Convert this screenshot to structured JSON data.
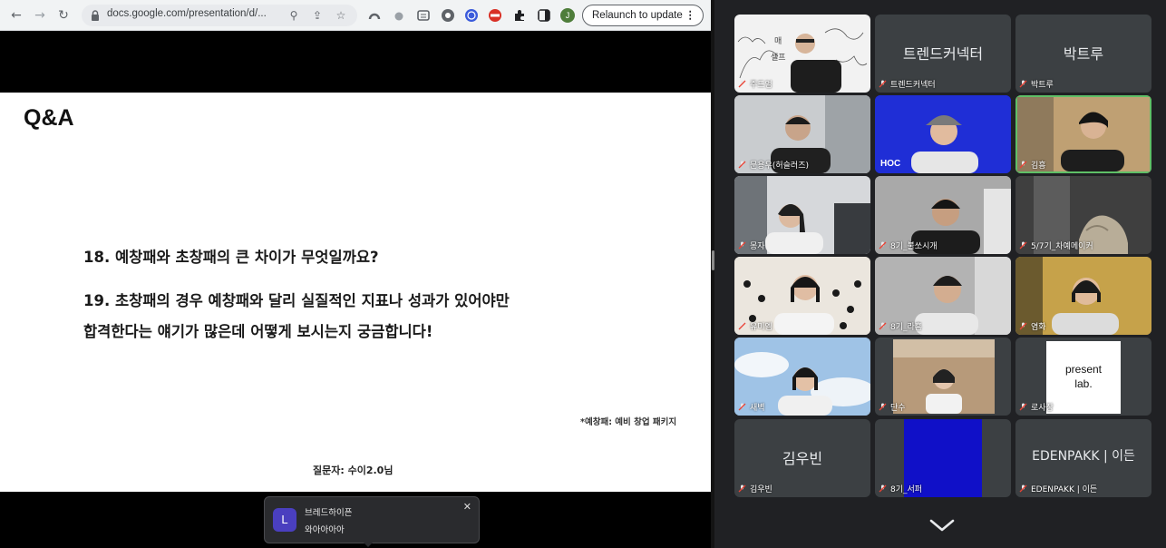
{
  "browser": {
    "url": "docs.google.com/presentation/d/...",
    "relaunch_label": "Relaunch to update",
    "profile_initial": "J"
  },
  "slide": {
    "title": "Q&A",
    "q18": "18. 예창패와 초창패의 큰 차이가 무엇일까요?",
    "q19_line1": "19. 초창패의 경우 예창패와 달리 실질적인 지표나 성과가 있어야만",
    "q19_line2": "합격한다는 얘기가 많은데 어떻게 보시는지 궁금합니다!",
    "footnote": "*예창패: 예비 창업 패키지",
    "asker": "질문자: 수이2.0님"
  },
  "chat": {
    "avatar_initial": "L",
    "sender": "브레드하이픈",
    "message": "와아아아아"
  },
  "meet": {
    "tiles": [
      {
        "label": "주드엄",
        "big": "",
        "video": true
      },
      {
        "label": "트렌드커넥터",
        "big": "트렌드커넥터",
        "video": false
      },
      {
        "label": "박트루",
        "big": "박트루",
        "video": false
      },
      {
        "label": "문용우(허슬러즈)",
        "big": "",
        "video": true
      },
      {
        "label": "HOC",
        "big": "",
        "video": true
      },
      {
        "label": "김흥",
        "big": "",
        "video": true,
        "active": true
      },
      {
        "label": "몽자",
        "big": "",
        "video": true
      },
      {
        "label": "8기_불쏘시개",
        "big": "",
        "video": true
      },
      {
        "label": "5/7기_차예메이커",
        "big": "",
        "video": true
      },
      {
        "label": "유미엠",
        "big": "",
        "video": true
      },
      {
        "label": "8기_라흠",
        "big": "",
        "video": true
      },
      {
        "label": "염화",
        "big": "",
        "video": true
      },
      {
        "label": "새벽",
        "big": "",
        "video": true
      },
      {
        "label": "단수",
        "big": "",
        "video": true
      },
      {
        "label": "로사장",
        "big": "",
        "video": true
      },
      {
        "label": "김우빈",
        "big": "김우빈",
        "video": false
      },
      {
        "label": "8기_서퍼",
        "big": "",
        "video": true
      },
      {
        "label": "EDENPAKK | 이든",
        "big": "EDENPAKK | 이든",
        "video": false
      }
    ],
    "present_logo_line1": "present",
    "present_logo_line2": "lab.",
    "hoc_text": "HOC",
    "tile1_sign": "매",
    "tile1_sign2": "셀프"
  }
}
